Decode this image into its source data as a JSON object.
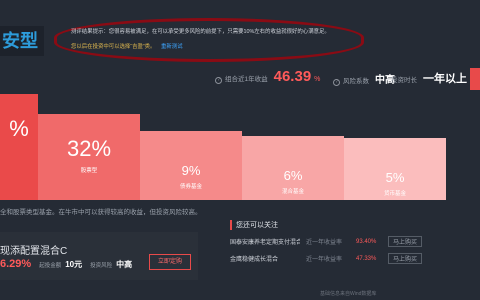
{
  "header": {
    "title": "安型"
  },
  "notice": {
    "line1": "测评结果提示：您很容易被满足，在可以承受更多风险的前提下，只需要10%左右的收益就很好的心满意足。",
    "line2": "您以后在投资中可以选择“吉盈”类。",
    "link": "重新测试"
  },
  "stats": {
    "return_label": "组合近1年收益",
    "return_value": "46.39",
    "return_unit": "%",
    "risk_label": "风险系数",
    "risk_value": "中高",
    "term_label": "投资时长",
    "term_value": "一年以上"
  },
  "chart_data": {
    "type": "bar",
    "categories": [
      "",
      "股票型",
      "债券基金",
      "混合基金",
      "货币基金"
    ],
    "values": [
      100,
      32,
      9,
      6,
      5
    ],
    "labels": [
      "%",
      "32%",
      "9%",
      "6%",
      "5%"
    ],
    "colors": [
      "#ea4a4a",
      "#f06a6a",
      "#f58a8a",
      "#f8a6a6",
      "#fbbdbd"
    ],
    "ylim": [
      0,
      100
    ]
  },
  "description": "全和股票类型基金。在牛市中可以获得较高的收益，但投资风险较高。",
  "fund_card": {
    "name": "现添配置混合C",
    "return": "6.29%",
    "invest_label": "起投金额",
    "invest_value": "10元",
    "risk_label": "投资风险",
    "risk_value": "中高",
    "button": "立即定购"
  },
  "focus": {
    "header": "您还可以关注",
    "items": [
      {
        "name": "国泰安康养老定期支付混合C",
        "rlabel": "近一年收益率",
        "rvalue": "93.40%",
        "button": "马上购买"
      },
      {
        "name": "金鹰稳健成长混合",
        "rlabel": "近一年收益率",
        "rvalue": "47.33%",
        "button": "马上购买"
      }
    ]
  },
  "footer": "基础信息来自Wind数据库"
}
